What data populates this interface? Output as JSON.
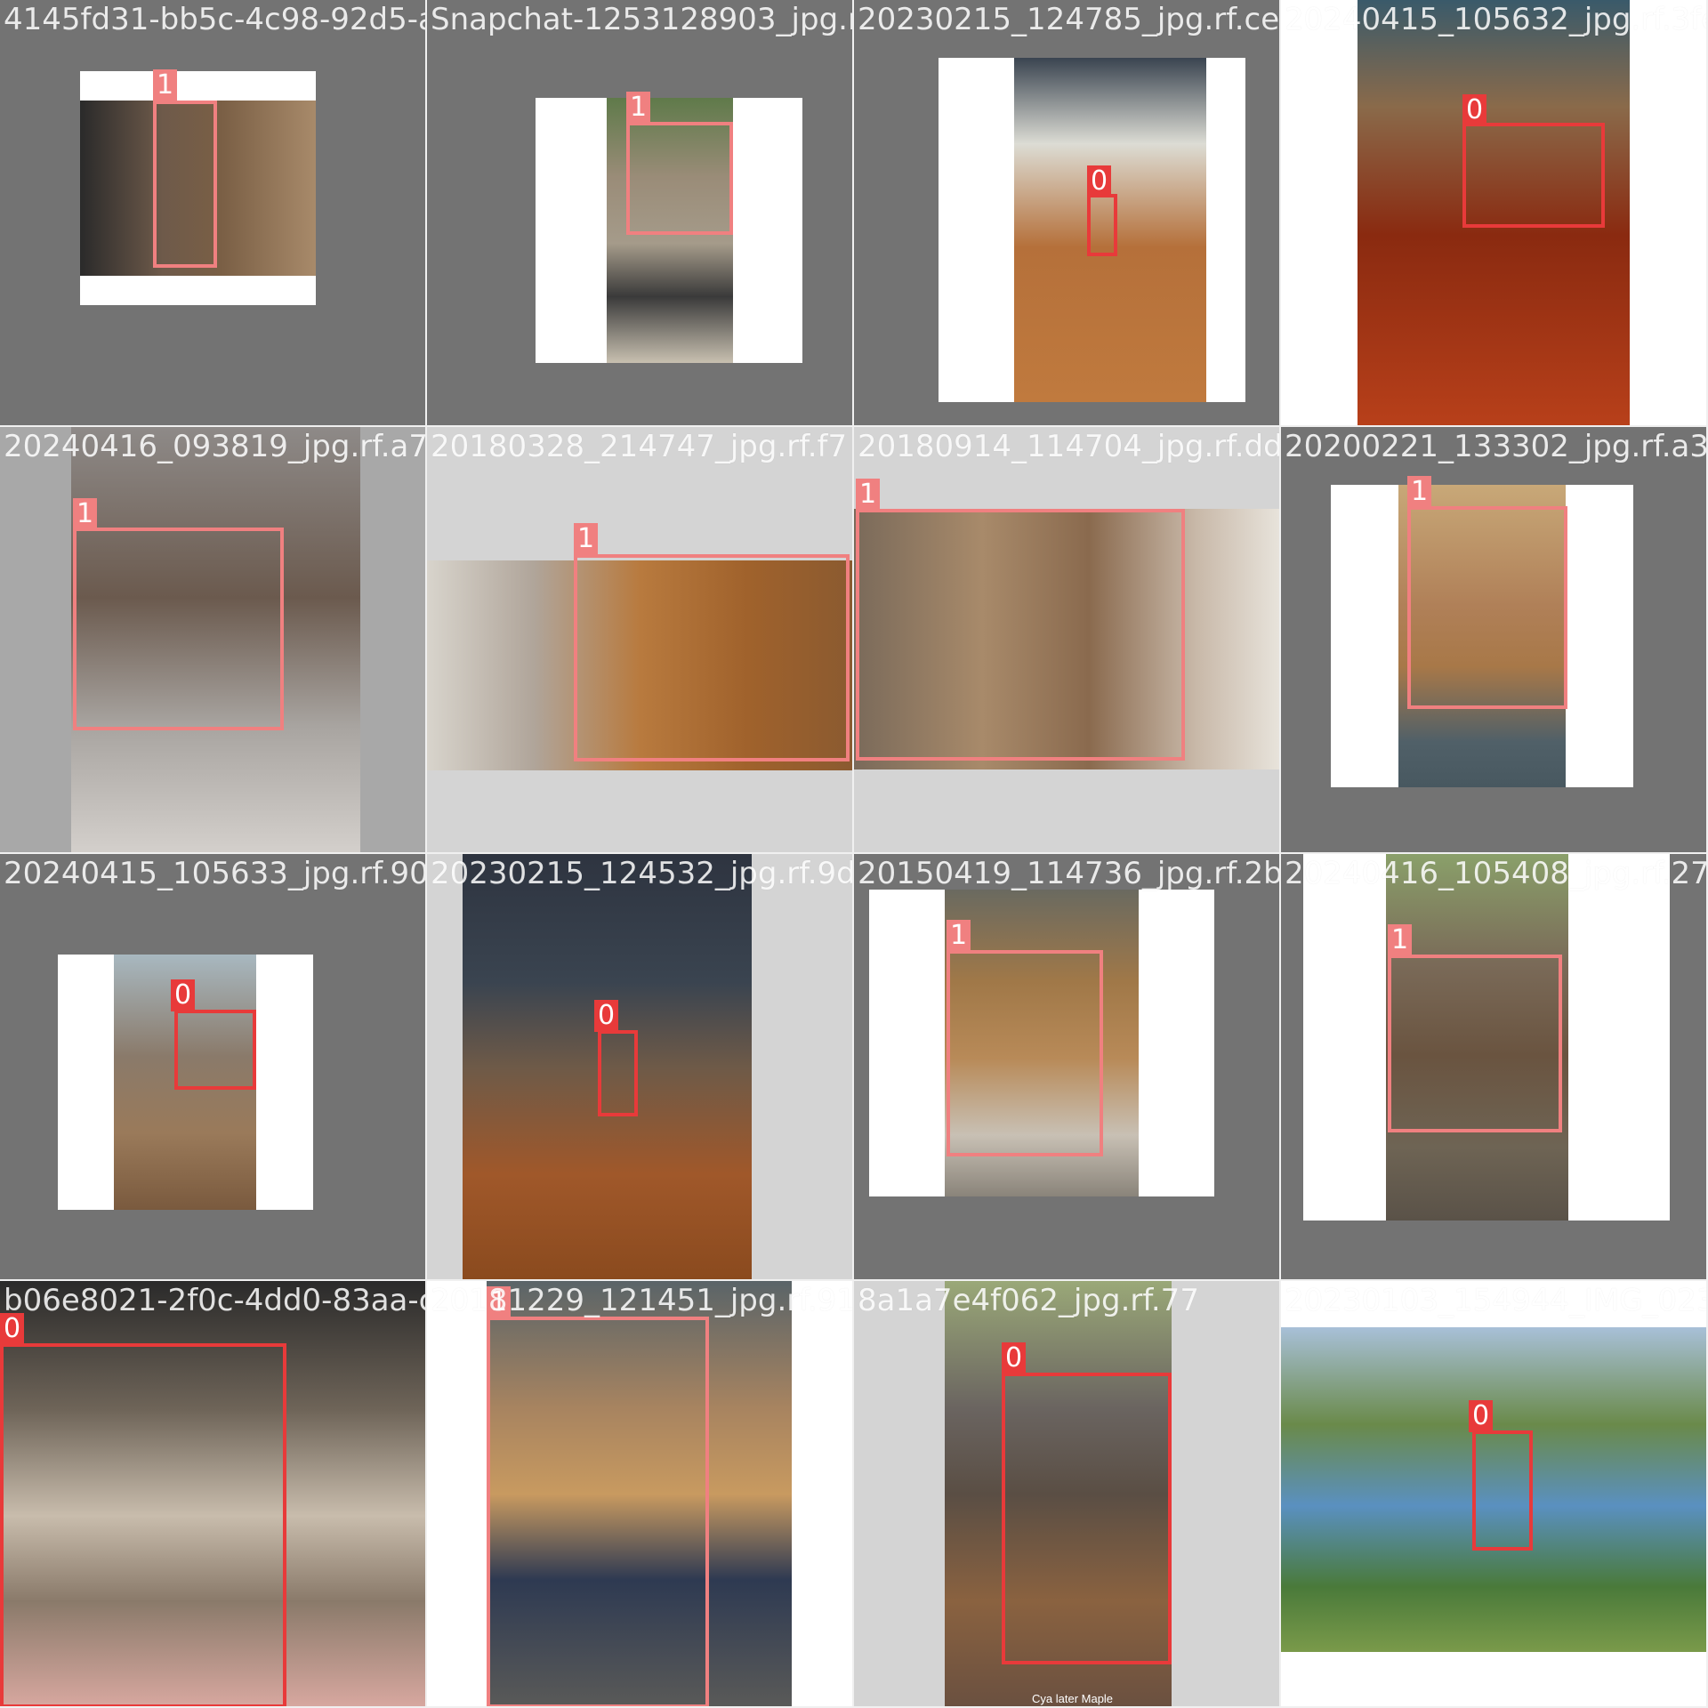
{
  "mosaic": {
    "cells": [
      {
        "filename": "4145fd31-bb5c-4c98-92d5-a5a4cb5a-4253128903_jpg.rf",
        "labels": [
          "1"
        ]
      },
      {
        "filename": "Snapchat-1253128903_jpg.rf",
        "labels": [
          "1"
        ]
      },
      {
        "filename": "20230215_124785_jpg.rf.ce",
        "labels": [
          "0"
        ]
      },
      {
        "filename": "20240415_105632_jpg.rf.3fe",
        "labels": [
          "0"
        ]
      },
      {
        "filename": "20240416_093819_jpg.rf.a7",
        "labels": [
          "1"
        ]
      },
      {
        "filename": "20180328_214747_jpg.rf.f7",
        "labels": [
          "1"
        ]
      },
      {
        "filename": "20180914_114704_jpg.rf.dd",
        "labels": [
          "1"
        ]
      },
      {
        "filename": "20200221_133302_jpg.rf.a3",
        "labels": [
          "1"
        ]
      },
      {
        "filename": "20240415_105633_jpg.rf.90",
        "labels": [
          "0"
        ]
      },
      {
        "filename": "20230215_124532_jpg.rf.9d",
        "labels": [
          "0"
        ]
      },
      {
        "filename": "20150419_114736_jpg.rf.2b",
        "labels": [
          "1"
        ]
      },
      {
        "filename": "20240416_105408_jpg.rf.27",
        "labels": [
          "1"
        ]
      },
      {
        "filename": "b06e8021-2f0c-4dd0-83aa-c",
        "labels": [
          "0"
        ]
      },
      {
        "filename": "20181229_121451_jpg.rf.91",
        "labels": [
          "1"
        ]
      },
      {
        "filename": "8a1a7e4f062_jpg.rf.77",
        "labels": [
          "0"
        ],
        "caption": "Cya later Maple"
      },
      {
        "filename": "20230103_154944_IMG_023",
        "labels": [
          "0"
        ]
      }
    ]
  },
  "colors": {
    "class_0": "#e83a3a",
    "class_1": "#f08080",
    "pad_dark": "#737373",
    "pad_light": "#a8a8a8",
    "pad_white": "#ffffff"
  }
}
